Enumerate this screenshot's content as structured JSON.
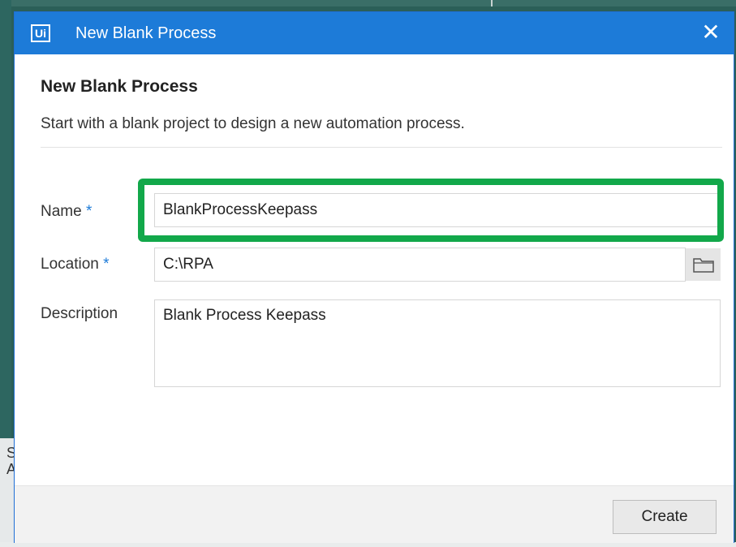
{
  "dialog": {
    "app_logo": "Ui",
    "title": "New Blank Process",
    "close_glyph": "✕",
    "heading": "New Blank Process",
    "subtitle": "Start with a blank project to design a new automation process."
  },
  "form": {
    "name": {
      "label": "Name",
      "required_mark": "*",
      "value": "BlankProcessKeepass"
    },
    "location": {
      "label": "Location",
      "required_mark": "*",
      "value": "C:\\RPA",
      "browse_icon": "folder-icon"
    },
    "description": {
      "label": "Description",
      "value": "Blank Process Keepass"
    }
  },
  "footer": {
    "create_label": "Create"
  },
  "background": {
    "letter_1": "S",
    "letter_2": "A"
  },
  "colors": {
    "titlebar": "#1d7bd8",
    "highlight": "#12a84a",
    "required": "#1d7bd8"
  }
}
